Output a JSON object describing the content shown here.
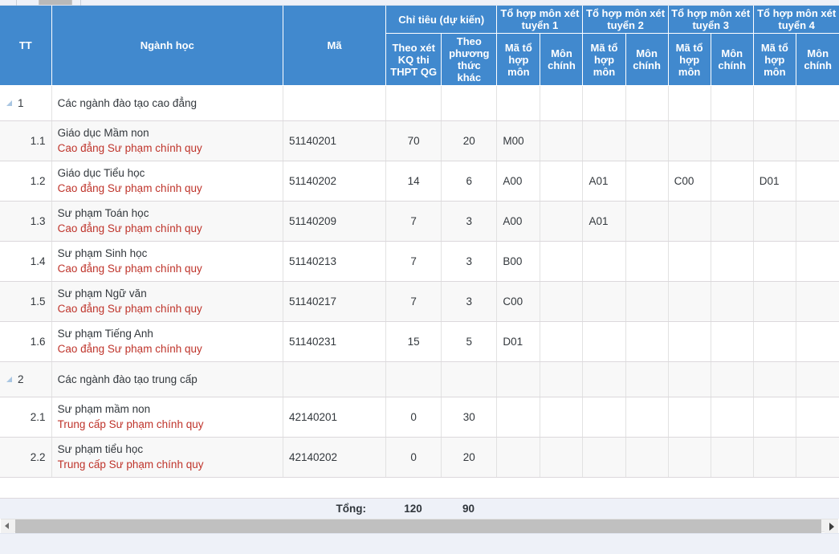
{
  "table": {
    "headers": {
      "tt": "TT",
      "nganh_hoc": "Ngành học",
      "ma": "Mã",
      "chi_tieu_group": "Chỉ tiêu (dự kiến)",
      "theo_xet_kq": "Theo xét KQ thi THPT QG",
      "theo_phuong_thuc_khac": "Theo phương thức khác",
      "to_hop_1": "Tổ hợp môn xét tuyển 1",
      "to_hop_2": "Tổ hợp môn xét tuyển 2",
      "to_hop_3": "Tổ hợp môn xét tuyển 3",
      "to_hop_4": "Tổ hợp môn xét tuyển 4",
      "ma_to_hop_mon": "Mã tổ hợp môn",
      "mon_chinh": "Môn chính"
    },
    "rows": [
      {
        "type": "group",
        "tt": "1",
        "name": "Các ngành đào tạo cao đẳng",
        "ma": "",
        "kq": "",
        "khac": "",
        "mth1": "",
        "mc1": "",
        "mth2": "",
        "mc2": "",
        "mth3": "",
        "mc3": "",
        "mth4": "",
        "mc4": ""
      },
      {
        "type": "item",
        "tt": "1.1",
        "name": "Giáo dục Mầm non",
        "sub": "Cao đẳng Sư phạm chính quy",
        "ma": "51140201",
        "kq": "70",
        "khac": "20",
        "mth1": "M00",
        "mc1": "",
        "mth2": "",
        "mc2": "",
        "mth3": "",
        "mc3": "",
        "mth4": "",
        "mc4": ""
      },
      {
        "type": "item",
        "tt": "1.2",
        "name": "Giáo dục Tiểu học",
        "sub": "Cao đẳng Sư phạm chính quy",
        "ma": "51140202",
        "kq": "14",
        "khac": "6",
        "mth1": "A00",
        "mc1": "",
        "mth2": "A01",
        "mc2": "",
        "mth3": "C00",
        "mc3": "",
        "mth4": "D01",
        "mc4": ""
      },
      {
        "type": "item",
        "tt": "1.3",
        "name": "Sư phạm Toán học",
        "sub": "Cao đẳng Sư phạm chính quy",
        "ma": "51140209",
        "kq": "7",
        "khac": "3",
        "mth1": "A00",
        "mc1": "",
        "mth2": "A01",
        "mc2": "",
        "mth3": "",
        "mc3": "",
        "mth4": "",
        "mc4": ""
      },
      {
        "type": "item",
        "tt": "1.4",
        "name": "Sư phạm Sinh học",
        "sub": "Cao đẳng Sư phạm chính quy",
        "ma": "51140213",
        "kq": "7",
        "khac": "3",
        "mth1": "B00",
        "mc1": "",
        "mth2": "",
        "mc2": "",
        "mth3": "",
        "mc3": "",
        "mth4": "",
        "mc4": ""
      },
      {
        "type": "item",
        "tt": "1.5",
        "name": "Sư phạm Ngữ văn",
        "sub": "Cao đẳng Sư phạm chính quy",
        "ma": "51140217",
        "kq": "7",
        "khac": "3",
        "mth1": "C00",
        "mc1": "",
        "mth2": "",
        "mc2": "",
        "mth3": "",
        "mc3": "",
        "mth4": "",
        "mc4": ""
      },
      {
        "type": "item",
        "tt": "1.6",
        "name": "Sư phạm Tiếng Anh",
        "sub": "Cao đẳng Sư phạm chính quy",
        "ma": "51140231",
        "kq": "15",
        "khac": "5",
        "mth1": "D01",
        "mc1": "",
        "mth2": "",
        "mc2": "",
        "mth3": "",
        "mc3": "",
        "mth4": "",
        "mc4": ""
      },
      {
        "type": "group",
        "tt": "2",
        "name": "Các ngành đào tạo trung cấp",
        "ma": "",
        "kq": "",
        "khac": "",
        "mth1": "",
        "mc1": "",
        "mth2": "",
        "mc2": "",
        "mth3": "",
        "mc3": "",
        "mth4": "",
        "mc4": ""
      },
      {
        "type": "item",
        "tt": "2.1",
        "name": "Sư phạm mầm non",
        "sub": "Trung cấp Sư phạm chính quy",
        "ma": "42140201",
        "kq": "0",
        "khac": "30",
        "mth1": "",
        "mc1": "",
        "mth2": "",
        "mc2": "",
        "mth3": "",
        "mc3": "",
        "mth4": "",
        "mc4": ""
      },
      {
        "type": "item",
        "tt": "2.2",
        "name": "Sư phạm tiểu học",
        "sub": "Trung cấp Sư phạm chính quy",
        "ma": "42140202",
        "kq": "0",
        "khac": "20",
        "mth1": "",
        "mc1": "",
        "mth2": "",
        "mc2": "",
        "mth3": "",
        "mc3": "",
        "mth4": "",
        "mc4": ""
      }
    ],
    "footer": {
      "label": "Tổng:",
      "total_kq": "120",
      "total_khac": "90"
    }
  },
  "colors": {
    "header_blue": "#4189ce",
    "sub_red": "#bf342b",
    "footer_bg": "#eef1f8",
    "alt_row": "#f8f8f8",
    "scroll_thumb": "#c0c0c0"
  }
}
